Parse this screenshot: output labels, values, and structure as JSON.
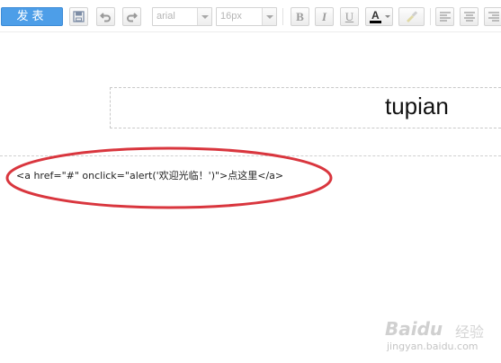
{
  "toolbar": {
    "publish_label": "发表",
    "font_family": "arial",
    "font_size": "16px",
    "bold_label": "B",
    "italic_label": "I",
    "underline_label": "U",
    "font_color_label": "A",
    "font_color_swatch": "#000000"
  },
  "editor": {
    "image_placeholder_text": "tupian",
    "code_text": "<a href=\"#\" onclick=\"alert('欢迎光临！')\">点这里</a>",
    "annotation_color": "#d9363e"
  },
  "watermark": {
    "brand": "Baidu",
    "product": "经验",
    "url": "jingyan.baidu.com"
  },
  "colors": {
    "accent": "#4d9ee8",
    "annotation": "#d9363e"
  }
}
